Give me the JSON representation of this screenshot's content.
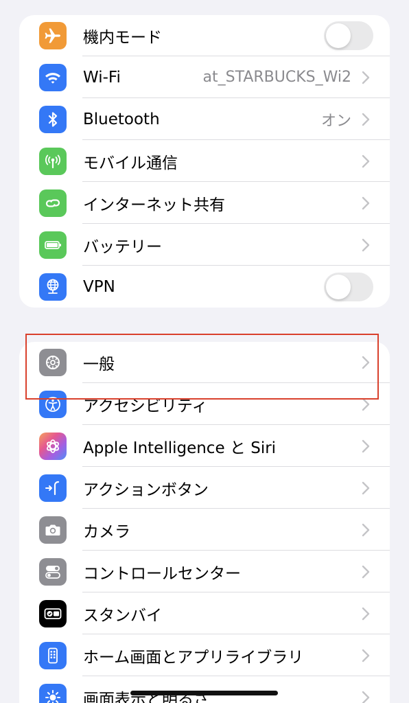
{
  "group1": [
    {
      "label": "機内モード",
      "icon": "airplane-icon",
      "color": "#f19a37",
      "control": "toggle",
      "on": false
    },
    {
      "label": "Wi-Fi",
      "icon": "wifi-icon",
      "color": "#3478f6",
      "value": "at_STARBUCKS_Wi2",
      "control": "chevron"
    },
    {
      "label": "Bluetooth",
      "icon": "bluetooth-icon",
      "color": "#3478f6",
      "value": "オン",
      "control": "chevron"
    },
    {
      "label": "モバイル通信",
      "icon": "antenna-icon",
      "color": "#5ac85a",
      "control": "chevron"
    },
    {
      "label": "インターネット共有",
      "icon": "link-icon",
      "color": "#5ac85a",
      "control": "chevron"
    },
    {
      "label": "バッテリー",
      "icon": "battery-icon",
      "color": "#5ac85a",
      "control": "chevron"
    },
    {
      "label": "VPN",
      "icon": "globe-network-icon",
      "color": "#3478f6",
      "control": "toggle",
      "on": false
    }
  ],
  "group2": [
    {
      "label": "一般",
      "icon": "gear-icon",
      "color": "#8e8e93",
      "control": "chevron"
    },
    {
      "label": "アクセシビリティ",
      "icon": "accessibility-icon",
      "color": "#3478f6",
      "control": "chevron"
    },
    {
      "label": "Apple Intelligence と Siri",
      "icon": "apple-intelligence-icon",
      "color": "#c15bd8",
      "control": "chevron"
    },
    {
      "label": "アクションボタン",
      "icon": "action-button-icon",
      "color": "#3478f6",
      "control": "chevron"
    },
    {
      "label": "カメラ",
      "icon": "camera-icon",
      "color": "#8e8e93",
      "control": "chevron"
    },
    {
      "label": "コントロールセンター",
      "icon": "control-center-icon",
      "color": "#8e8e93",
      "control": "chevron"
    },
    {
      "label": "スタンバイ",
      "icon": "standby-icon",
      "color": "#000000",
      "control": "chevron"
    },
    {
      "label": "ホーム画面とアプリライブラリ",
      "icon": "home-screen-icon",
      "color": "#3478f6",
      "control": "chevron"
    },
    {
      "label": "画面表示と明るさ",
      "icon": "brightness-icon",
      "color": "#3478f6",
      "control": "chevron"
    }
  ],
  "colors": {
    "background": "#f2f2f7",
    "highlight": "#d9402c"
  }
}
